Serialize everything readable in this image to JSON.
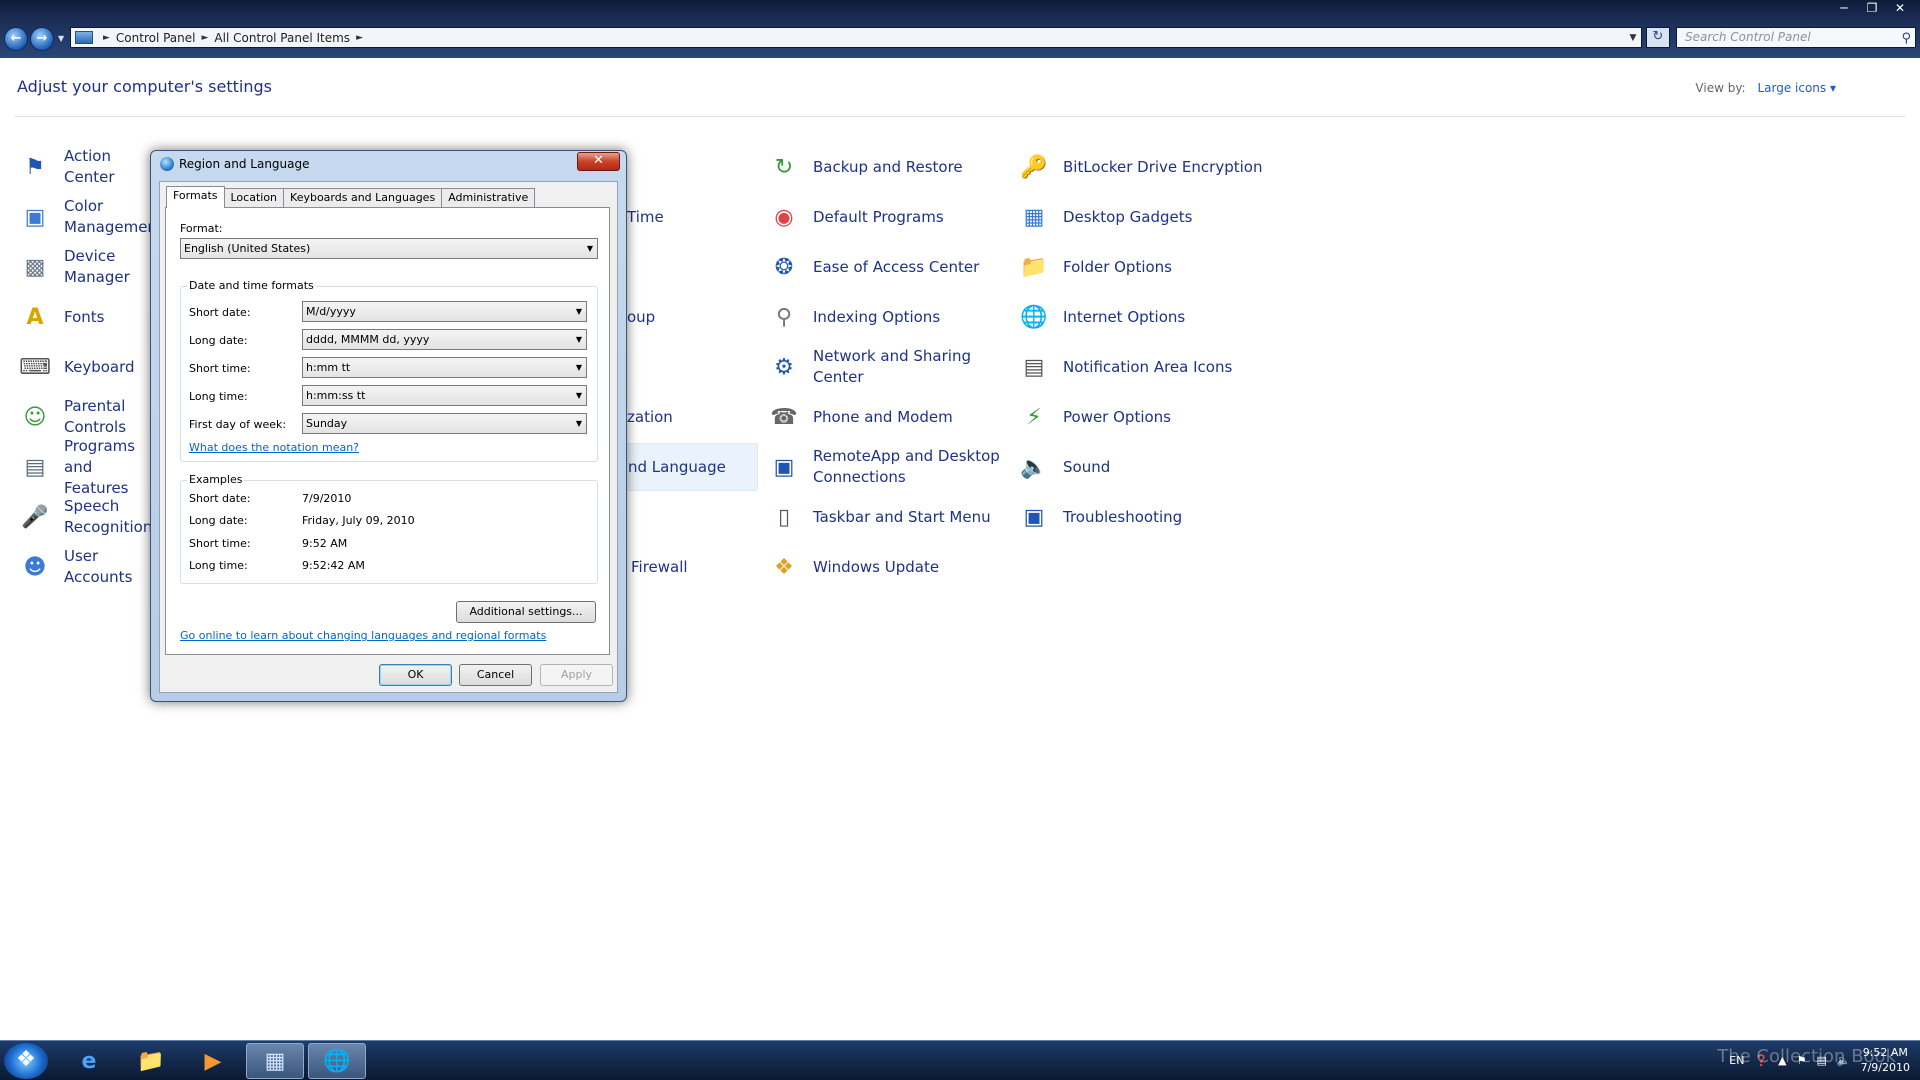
{
  "explorer": {
    "breadcrumb": [
      "Control Panel",
      "All Control Panel Items"
    ],
    "search_placeholder": "Search Control Panel",
    "heading": "Adjust your computer's settings",
    "view_by_label": "View by:",
    "view_by_value": "Large icons"
  },
  "cp_items": [
    {
      "label": "Action Center",
      "icon": "flag-icon"
    },
    {
      "label": "Color Management",
      "icon": "color-management-icon"
    },
    {
      "label": "Device Manager",
      "icon": "device-manager-icon"
    },
    {
      "label": "Fonts",
      "icon": "fonts-icon"
    },
    {
      "label": "Keyboard",
      "icon": "keyboard-icon"
    },
    {
      "label": "Parental Controls",
      "icon": "parental-controls-icon"
    },
    {
      "label": "Programs and Features",
      "icon": "programs-icon"
    },
    {
      "label": "Speech Recognition",
      "icon": "microphone-icon"
    },
    {
      "label": "User Accounts",
      "icon": "user-accounts-icon"
    },
    {
      "label": "Time",
      "icon": ""
    },
    {
      "label": "oup",
      "icon": ""
    },
    {
      "label": "zation",
      "icon": ""
    },
    {
      "label": "nd Language",
      "icon": ""
    },
    {
      "label": "Firewall",
      "icon": ""
    },
    {
      "label": "Backup and Restore",
      "icon": "backup-icon"
    },
    {
      "label": "Default Programs",
      "icon": "default-programs-icon"
    },
    {
      "label": "Ease of Access Center",
      "icon": "ease-of-access-icon"
    },
    {
      "label": "Indexing Options",
      "icon": "indexing-icon"
    },
    {
      "label": "Network and Sharing Center",
      "icon": "network-icon"
    },
    {
      "label": "Phone and Modem",
      "icon": "phone-icon"
    },
    {
      "label": "RemoteApp and Desktop Connections",
      "icon": "remoteapp-icon"
    },
    {
      "label": "Taskbar and Start Menu",
      "icon": "taskbar-icon"
    },
    {
      "label": "Windows Update",
      "icon": "windows-update-icon"
    },
    {
      "label": "BitLocker Drive Encryption",
      "icon": "bitlocker-icon"
    },
    {
      "label": "Desktop Gadgets",
      "icon": "gadgets-icon"
    },
    {
      "label": "Folder Options",
      "icon": "folder-icon"
    },
    {
      "label": "Internet Options",
      "icon": "internet-options-icon"
    },
    {
      "label": "Notification Area Icons",
      "icon": "notification-icon"
    },
    {
      "label": "Power Options",
      "icon": "power-icon"
    },
    {
      "label": "Sound",
      "icon": "sound-icon"
    },
    {
      "label": "Troubleshooting",
      "icon": "troubleshooting-icon"
    }
  ],
  "dialog": {
    "title": "Region and Language",
    "tabs": [
      "Formats",
      "Location",
      "Keyboards and Languages",
      "Administrative"
    ],
    "format_label": "Format:",
    "format_value": "English (United States)",
    "dt_group_title": "Date and time formats",
    "fields": [
      {
        "label": "Short date:",
        "value": "M/d/yyyy"
      },
      {
        "label": "Long date:",
        "value": "dddd, MMMM dd, yyyy"
      },
      {
        "label": "Short time:",
        "value": "h:mm tt"
      },
      {
        "label": "Long time:",
        "value": "h:mm:ss tt"
      },
      {
        "label": "First day of week:",
        "value": "Sunday"
      }
    ],
    "notation_link": "What does the notation mean?",
    "examples_title": "Examples",
    "examples": [
      {
        "label": "Short date:",
        "value": "7/9/2010"
      },
      {
        "label": "Long date:",
        "value": "Friday, July 09, 2010"
      },
      {
        "label": "Short time:",
        "value": "9:52 AM"
      },
      {
        "label": "Long time:",
        "value": "9:52:42 AM"
      }
    ],
    "additional_button": "Additional settings...",
    "online_link": "Go online to learn about changing languages and regional formats",
    "ok": "OK",
    "cancel": "Cancel",
    "apply": "Apply"
  },
  "taskbar": {
    "lang": "EN",
    "time": "9:52 AM",
    "date": "7/9/2010",
    "watermark": "The Collection Book"
  }
}
